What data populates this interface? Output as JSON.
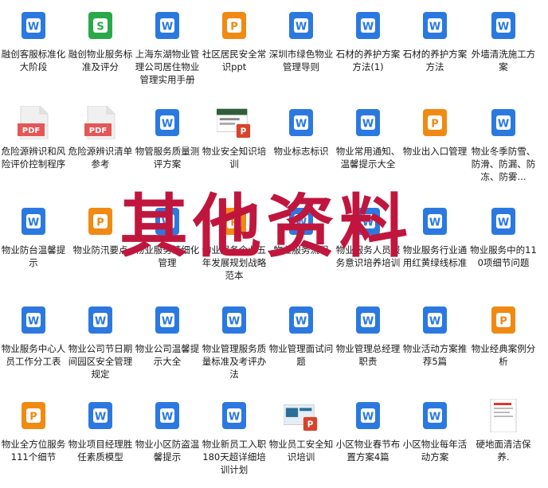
{
  "files": [
    {
      "name": "融创客服标准化大阶段",
      "type": "word"
    },
    {
      "name": "融创物业服务标准及评分",
      "type": "wps"
    },
    {
      "name": "上海东湖物业管理公司居住物业管理实用手册",
      "type": "word"
    },
    {
      "name": "社区居民安全常识ppt",
      "type": "ppt"
    },
    {
      "name": "深圳市绿色物业管理导则",
      "type": "word"
    },
    {
      "name": "石材的养护方案方法(1)",
      "type": "word"
    },
    {
      "name": "石材的养护方案方法",
      "type": "word"
    },
    {
      "name": "外墙清洗施工方案",
      "type": "word"
    },
    {
      "name": "危险源辨识和风险评价控制程序",
      "type": "pdf"
    },
    {
      "name": "危险源辨识清单参考",
      "type": "pdf"
    },
    {
      "name": "物管服务质量测评方案",
      "type": "word"
    },
    {
      "name": "物业安全知识培训",
      "type": "thumb-ppt"
    },
    {
      "name": "物业标志标识",
      "type": "word"
    },
    {
      "name": "物业常用通知、温馨提示大全",
      "type": "word"
    },
    {
      "name": "物业出入口管理",
      "type": "ppt"
    },
    {
      "name": "物业冬季防雪、防滑、防漏、防冻、防雾...",
      "type": "word"
    },
    {
      "name": "物业防台温馨提示",
      "type": "word"
    },
    {
      "name": "物业防汛要点",
      "type": "ppt"
    },
    {
      "name": "物业服务精细化管理",
      "type": "word"
    },
    {
      "name": "物业服务企业五年发展规划战略范本",
      "type": "ppt"
    },
    {
      "name": "物业服务流程",
      "type": "word"
    },
    {
      "name": "物业服务人员服务意识培养培训",
      "type": "word"
    },
    {
      "name": "物业服务行业通用红黄绿线标准",
      "type": "word"
    },
    {
      "name": "物业服务中的110项细节问题",
      "type": "word"
    },
    {
      "name": "物业服务中心人员工作分工表",
      "type": "word"
    },
    {
      "name": "物业公司节日期间园区安全管理规定",
      "type": "word"
    },
    {
      "name": "物业公司温馨提示大全",
      "type": "word"
    },
    {
      "name": "物业管理服务质量标准及考评办法",
      "type": "word"
    },
    {
      "name": "物业管理面试问题",
      "type": "word"
    },
    {
      "name": "物业管理总经理职责",
      "type": "word"
    },
    {
      "name": "物业活动方案推荐5篇",
      "type": "word"
    },
    {
      "name": "物业经典案例分析",
      "type": "ppt"
    },
    {
      "name": "物业全方位服务111个细节",
      "type": "ppt"
    },
    {
      "name": "物业项目经理胜任素质模型",
      "type": "word"
    },
    {
      "name": "物业小区防盗温馨提示",
      "type": "word"
    },
    {
      "name": "物业新员工入职180天超详细培训计划",
      "type": "word"
    },
    {
      "name": "物业员工安全知识培训",
      "type": "thumb-ppt2"
    },
    {
      "name": "小区物业春节布置方案4篇",
      "type": "word"
    },
    {
      "name": "小区物业每年活动方案",
      "type": "word"
    },
    {
      "name": "硬地面清洁保养.",
      "type": "thumb-doc"
    }
  ],
  "watermark": "其他资料",
  "labels": {
    "pdf": "PDF",
    "word": "W",
    "wps": "S",
    "ppt": "P"
  },
  "colors": {
    "word": "#2b79e0",
    "wps": "#2aa84a",
    "ppt": "#f08a12",
    "pdf": "#e55656",
    "watermark": "#c0163e"
  }
}
